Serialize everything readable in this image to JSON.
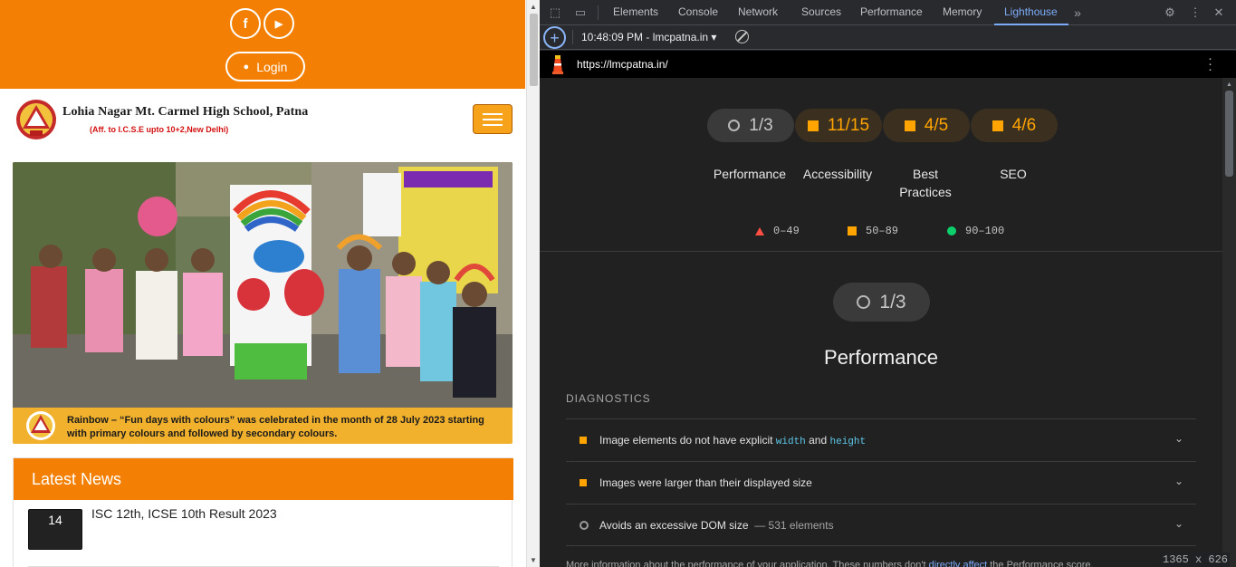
{
  "site": {
    "social": {
      "facebook_glyph": "f",
      "youtube_glyph": "▶"
    },
    "login_label": "Login",
    "school_name": "Lohia Nagar Mt. Carmel High School, Patna",
    "affiliation": "(Aff. to I.C.S.E upto 10+2,New Delhi)",
    "hero_caption": "Rainbow – “Fun days with colours” was celebrated in the month of 28 July 2023 starting with primary colours and followed by secondary colours.",
    "news": {
      "heading": "Latest News",
      "items": [
        {
          "day": "14",
          "title": "ISC 12th, ICSE 10th Result 2023"
        }
      ]
    },
    "colors": {
      "brand_orange": "#f38005",
      "caption_bg": "#f1b12d"
    }
  },
  "devtools": {
    "tabs": [
      "Elements",
      "Console",
      "Network",
      "Sources",
      "Performance",
      "Memory",
      "Lighthouse"
    ],
    "active_tab": "Lighthouse",
    "report_select": "10:48:09 PM - lmcpatna.in ▾",
    "url": "https://lmcpatna.in/",
    "scores": [
      {
        "value": "1/3",
        "label": "Performance",
        "kind": "gray"
      },
      {
        "value": "11/15",
        "label": "Accessibility",
        "kind": "orange"
      },
      {
        "value": "4/5",
        "label": "Best Practices",
        "kind": "orange"
      },
      {
        "value": "4/6",
        "label": "SEO",
        "kind": "orange"
      }
    ],
    "legend": {
      "fail": "0–49",
      "average": "50–89",
      "pass": "90–100"
    },
    "performance": {
      "score": "1/3",
      "title": "Performance",
      "section": "DIAGNOSTICS",
      "audits": [
        {
          "pre": "Image elements do not have explicit ",
          "code1": "width",
          "mid": " and ",
          "code2": "height",
          "status": "average"
        },
        {
          "text": "Images were larger than their displayed size",
          "status": "average"
        },
        {
          "text": "Avoids an excessive DOM size",
          "meta": "— 531 elements",
          "status": "informative"
        }
      ],
      "more_info_pre": "More information about the performance of your application. These numbers don't ",
      "more_info_link": "directly affect",
      "more_info_post": " the Performance score."
    },
    "colors": {
      "fail": "#ff4e42",
      "average": "#ffa400",
      "pass": "#0cce6b",
      "active_tab": "#7cacf8"
    }
  },
  "viewport_size": "1365 x 626"
}
